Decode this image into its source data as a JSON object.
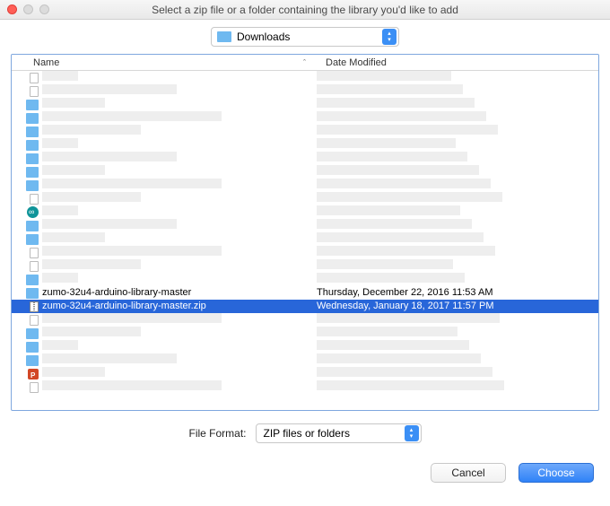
{
  "window": {
    "title": "Select a zip file or a folder containing the library you'd like to add"
  },
  "location": {
    "current": "Downloads"
  },
  "columns": {
    "name": "Name",
    "date": "Date Modified",
    "sort_indicator": "ˆ"
  },
  "rows": [
    {
      "icon": "doc-page",
      "name": "",
      "date": ""
    },
    {
      "icon": "doc-page",
      "name": "",
      "date": ""
    },
    {
      "icon": "folder",
      "name": "",
      "date": ""
    },
    {
      "icon": "folder",
      "name": "",
      "date": ""
    },
    {
      "icon": "folder",
      "name": "",
      "date": ""
    },
    {
      "icon": "folder",
      "name": "",
      "date": ""
    },
    {
      "icon": "folder",
      "name": "",
      "date": ""
    },
    {
      "icon": "folder",
      "name": "",
      "date": ""
    },
    {
      "icon": "folder",
      "name": "",
      "date": ""
    },
    {
      "icon": "doc",
      "name": "",
      "date": ""
    },
    {
      "icon": "arduino",
      "name": "",
      "date": ""
    },
    {
      "icon": "folder",
      "name": "",
      "date": ""
    },
    {
      "icon": "folder",
      "name": "",
      "date": ""
    },
    {
      "icon": "doc-page",
      "name": "",
      "date": ""
    },
    {
      "icon": "doc-page",
      "name": "",
      "date": ""
    },
    {
      "icon": "folder",
      "name": "",
      "date": ""
    },
    {
      "icon": "folder",
      "name": "zumo-32u4-arduino-library-master",
      "date": "Thursday, December 22, 2016 11:53 AM"
    },
    {
      "icon": "zip",
      "name": "zumo-32u4-arduino-library-master.zip",
      "date": "Wednesday, January 18, 2017 11:57 PM",
      "selected": true
    },
    {
      "icon": "doc-page",
      "name": "",
      "date": ""
    },
    {
      "icon": "folder",
      "name": "",
      "date": ""
    },
    {
      "icon": "folder",
      "name": "",
      "date": ""
    },
    {
      "icon": "folder",
      "name": "",
      "date": ""
    },
    {
      "icon": "ppt",
      "name": "",
      "date": ""
    },
    {
      "icon": "doc-page",
      "name": "",
      "date": ""
    }
  ],
  "format": {
    "label": "File Format:",
    "value": "ZIP files or folders"
  },
  "buttons": {
    "cancel": "Cancel",
    "choose": "Choose"
  }
}
